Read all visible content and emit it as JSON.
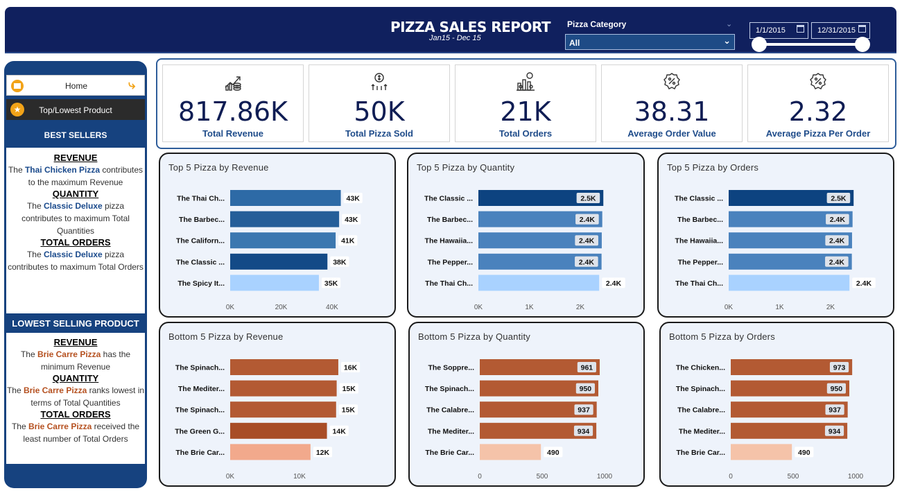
{
  "header": {
    "title": "PIZZA SALES REPORT",
    "subtitle": "Jan15 - Dec 15",
    "category_label": "Pizza Category",
    "category_value": "All",
    "date_start": "1/1/2015",
    "date_end": "12/31/2015"
  },
  "sidebar": {
    "home_label": "Home",
    "toplowest_label": "Top/Lowest Product",
    "best_heading": "BEST SELLERS",
    "best": {
      "revenue_h": "REVENUE",
      "revenue_pre": "The ",
      "revenue_name": "Thai Chicken Pizza",
      "revenue_post": " contributes to the maximum Revenue",
      "quantity_h": "QUANTITY",
      "quantity_pre": "The ",
      "quantity_name": "Classic Deluxe",
      "quantity_post": " pizza contributes to maximum Total Quantities",
      "orders_h": "TOTAL ORDERS",
      "orders_pre": "The ",
      "orders_name": "Classic Deluxe",
      "orders_post": " pizza contributes to maximum Total Orders"
    },
    "low_heading": "LOWEST SELLING PRODUCT",
    "low": {
      "revenue_h": "REVENUE",
      "revenue_pre": "The ",
      "revenue_name": "Brie Carre Pizza",
      "revenue_post": " has the minimum Revenue",
      "quantity_h": "QUANTITY",
      "quantity_pre": "The ",
      "quantity_name": "Brie Carre Pizza",
      "quantity_post": " ranks lowest in terms of Total Quantities",
      "orders_h": "TOTAL ORDERS",
      "orders_pre": "The ",
      "orders_name": "Brie Carre Pizza",
      "orders_post": " received the least number of Total Orders"
    }
  },
  "kpis": [
    {
      "value": "817.86K",
      "label": "Total Revenue",
      "icon": "revenue-chart-icon"
    },
    {
      "value": "50K",
      "label": "Total Pizza Sold",
      "icon": "dollar-growth-icon"
    },
    {
      "value": "21K",
      "label": "Total Orders",
      "icon": "orders-chart-icon"
    },
    {
      "value": "38.31",
      "label": "Average Order Value",
      "icon": "percent-badge-icon"
    },
    {
      "value": "2.32",
      "label": "Average Pizza Per Order",
      "icon": "percent-badge-icon"
    }
  ],
  "chart_data": [
    {
      "type": "bar",
      "orientation": "horizontal",
      "title": "Top 5 Pizza by Revenue",
      "categories": [
        "The Thai Ch...",
        "The Barbec...",
        "The Californ...",
        "The Classic ...",
        "The Spicy It..."
      ],
      "values": [
        43434,
        42768,
        41410,
        38180,
        34831
      ],
      "labels": [
        "43K",
        "43K",
        "41K",
        "38K",
        "35K"
      ],
      "colors": [
        "#2d6aa6",
        "#255e99",
        "#3b77b0",
        "#134a87",
        "#a9d2ff"
      ],
      "ticks": [
        "0K",
        "20K",
        "40K"
      ],
      "tick_values": [
        0,
        20000,
        40000
      ],
      "xlim": [
        0,
        49000
      ],
      "label_style": "plain"
    },
    {
      "type": "bar",
      "orientation": "horizontal",
      "title": "Top 5 Pizza by Quantity",
      "categories": [
        "The Classic ...",
        "The Barbec...",
        "The Hawaiia...",
        "The Pepper...",
        "The Thai Ch..."
      ],
      "values": [
        2453,
        2432,
        2422,
        2418,
        2371
      ],
      "labels": [
        "2.5K",
        "2.4K",
        "2.4K",
        "2.4K",
        "2.4K"
      ],
      "colors": [
        "#0d4380",
        "#4a82bd",
        "#4a82bd",
        "#4a82bd",
        "#a9d2ff"
      ],
      "ticks": [
        "0K",
        "1K",
        "2K"
      ],
      "tick_values": [
        0,
        1000,
        2000
      ],
      "xlim": [
        0,
        2450
      ],
      "label_style": "boxed"
    },
    {
      "type": "bar",
      "orientation": "horizontal",
      "title": "Top 5 Pizza by Orders",
      "categories": [
        "The Classic ...",
        "The Barbec...",
        "The Hawaiia...",
        "The Pepper...",
        "The Thai Ch..."
      ],
      "values": [
        2453,
        2432,
        2422,
        2418,
        2371
      ],
      "labels": [
        "2.5K",
        "2.4K",
        "2.4K",
        "2.4K",
        "2.4K"
      ],
      "colors": [
        "#0d4380",
        "#4a82bd",
        "#4a82bd",
        "#4a82bd",
        "#a9d2ff"
      ],
      "ticks": [
        "0K",
        "1K",
        "2K"
      ],
      "tick_values": [
        0,
        1000,
        2000
      ],
      "xlim": [
        0,
        2450
      ],
      "label_style": "boxed"
    },
    {
      "type": "bar",
      "orientation": "horizontal",
      "title": "Bottom 5 Pizza by Revenue",
      "categories": [
        "The Spinach...",
        "The Mediter...",
        "The Spinach...",
        "The Green G...",
        "The Brie Car..."
      ],
      "values": [
        15596,
        15361,
        15278,
        13956,
        11588
      ],
      "labels": [
        "16K",
        "15K",
        "15K",
        "14K",
        "12K"
      ],
      "colors": [
        "#b35a33",
        "#b35a33",
        "#b35a33",
        "#a84d27",
        "#f2a98c"
      ],
      "ticks": [
        "0K",
        "10K"
      ],
      "tick_values": [
        0,
        10000
      ],
      "xlim": [
        0,
        18000
      ],
      "label_style": "plain"
    },
    {
      "type": "bar",
      "orientation": "horizontal",
      "title": "Bottom 5 Pizza by Quantity",
      "categories": [
        "The Soppre...",
        "The Spinach...",
        "The Calabre...",
        "The Mediter...",
        "The Brie Car..."
      ],
      "values": [
        961,
        950,
        937,
        934,
        490
      ],
      "labels": [
        "961",
        "950",
        "937",
        "934",
        "490"
      ],
      "colors": [
        "#b35a33",
        "#b35a33",
        "#b35a33",
        "#b35a33",
        "#f5c3a9"
      ],
      "ticks": [
        "0",
        "500",
        "1000"
      ],
      "tick_values": [
        0,
        500,
        1000
      ],
      "xlim": [
        0,
        1000
      ],
      "label_style": "boxed"
    },
    {
      "type": "bar",
      "orientation": "horizontal",
      "title": "Bottom 5 Pizza by Orders",
      "categories": [
        "The Chicken...",
        "The Spinach...",
        "The Calabre...",
        "The Mediter...",
        "The Brie Car..."
      ],
      "values": [
        973,
        950,
        937,
        934,
        490
      ],
      "labels": [
        "973",
        "950",
        "937",
        "934",
        "490"
      ],
      "colors": [
        "#b35a33",
        "#b35a33",
        "#b35a33",
        "#b35a33",
        "#f5c3a9"
      ],
      "ticks": [
        "0",
        "500",
        "1000"
      ],
      "tick_values": [
        0,
        500,
        1000
      ],
      "xlim": [
        0,
        1000
      ],
      "label_style": "boxed"
    }
  ]
}
